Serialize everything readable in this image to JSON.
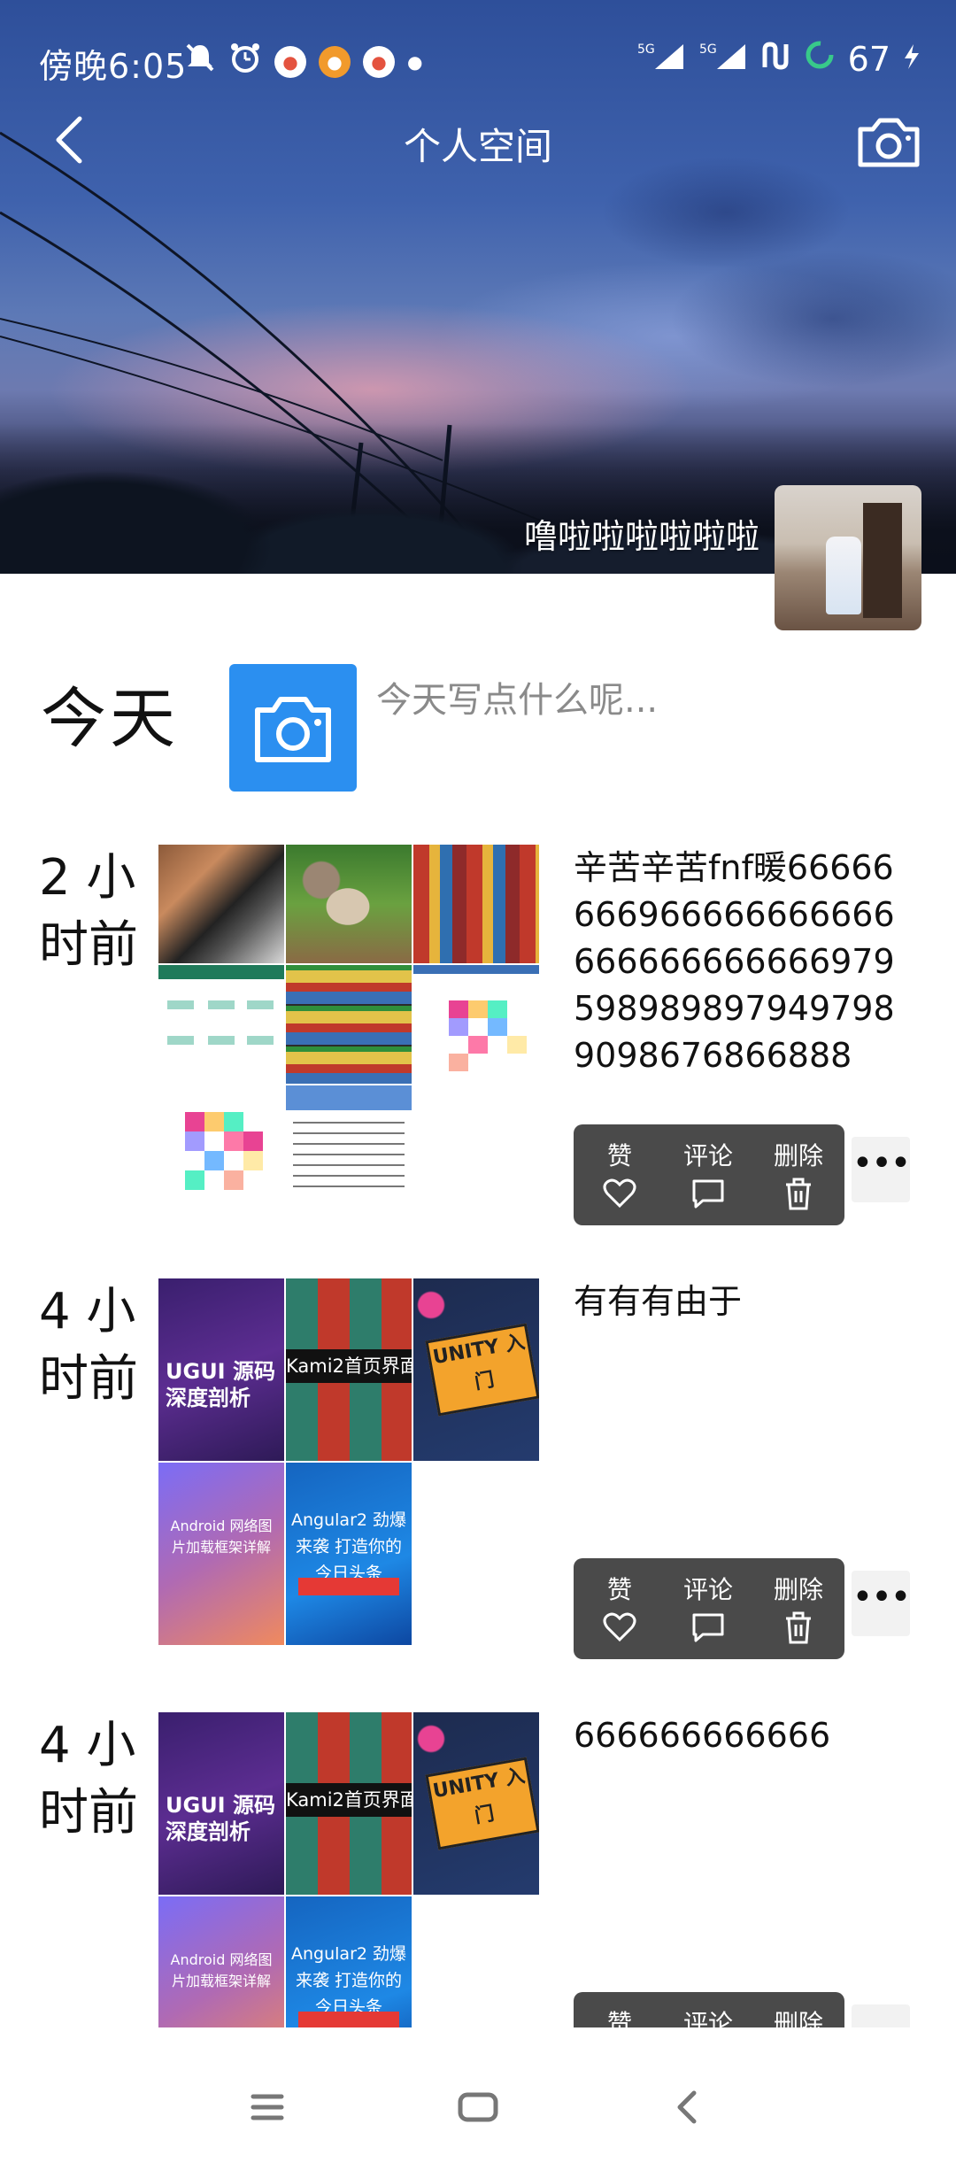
{
  "status_bar": {
    "time": "傍晚6:05",
    "network_1": "5G",
    "network_2": "5G",
    "battery": "67"
  },
  "header": {
    "title": "个人空间",
    "nickname": "噜啦啦啦啦啦啦"
  },
  "today": {
    "label": "今天",
    "prompt": "今天写点什么呢..."
  },
  "action_labels": {
    "like": "赞",
    "comment": "评论",
    "delete": "删除",
    "more": "•••"
  },
  "posts": [
    {
      "time_line1": "2 小",
      "time_line2": "时前",
      "text": "辛苦辛苦fnf暖666666669666666666666666666666669795989898979497989098676866888",
      "image_count": 8
    },
    {
      "time_line1": "4 小",
      "time_line2": "时前",
      "text": "有有有由于",
      "image_count": 5,
      "image_texts": [
        "UGUI 源码深度剖析",
        "Kami2首页界面切换效果",
        "UNITY 入门",
        "Android 网络图片加载框架详解",
        "Angular2 劲爆来袭 打造你的今日头条"
      ]
    },
    {
      "time_line1": "4 小",
      "time_line2": "时前",
      "text": "666666666666",
      "image_count": 5,
      "image_texts": [
        "UGUI 源码深度剖析",
        "Kami2首页界面切换效果",
        "UNITY 入门",
        "Android 网络图片加载框架详解",
        "Angular2 劲爆来袭 打造你的今日头条"
      ]
    }
  ]
}
